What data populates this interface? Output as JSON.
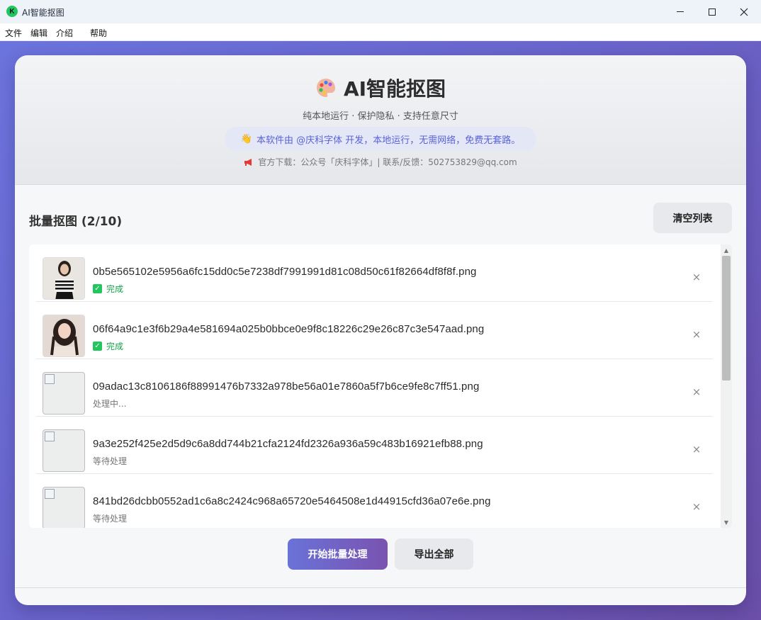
{
  "window": {
    "title": "AI智能抠图",
    "icon_letter": "K"
  },
  "menu": [
    "文件",
    "编辑",
    "介绍",
    "帮助"
  ],
  "header": {
    "title": "AI智能抠图",
    "subtitle": "纯本地运行 · 保护隐私 · 支持任意尺寸",
    "notice": "本软件由 @庆科字体 开发，本地运行，无需网络，免费无套路。",
    "download_line": "官方下载：公众号「庆科字体」| 联系/反馈：502753829@qq.com"
  },
  "batch": {
    "title": "批量抠图 (2/10)",
    "clear_label": "清空列表"
  },
  "files": [
    {
      "name": "0b5e565102e5956a6fc15dd0c5e7238df7991991d81c08d50c61f82664df8f8f.png",
      "status": "完成",
      "state": "done",
      "thumb": "photo-a"
    },
    {
      "name": "06f64a9c1e3f6b29a4e581694a025b0bbce0e9f8c18226c29e26c87c3e547aad.png",
      "status": "完成",
      "state": "done",
      "thumb": "photo-b"
    },
    {
      "name": "09adac13c8106186f88991476b7332a978be56a01e7860a5f7b6ce9fe8c7ff51.png",
      "status": "处理中...",
      "state": "processing",
      "thumb": "broken"
    },
    {
      "name": "9a3e252f425e2d5d9c6a8dd744b21cfa2124fd2326a936a59c483b16921efb88.png",
      "status": "等待处理",
      "state": "pending",
      "thumb": "broken"
    },
    {
      "name": "841bd26dcbb0552ad1c6a8c2424c968a65720e5464508e1d44915cfd36a07e6e.png",
      "status": "等待处理",
      "state": "pending",
      "thumb": "broken"
    }
  ],
  "actions": {
    "start_label": "开始批量处理",
    "export_label": "导出全部"
  },
  "colors": {
    "accent": "#6a72d8",
    "success": "#16a34a",
    "gradient_start": "#6b74dd",
    "gradient_end": "#6b4fa8"
  }
}
